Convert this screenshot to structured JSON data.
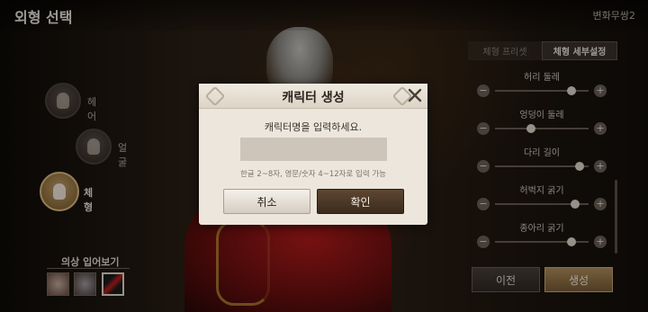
{
  "header": {
    "title": "외형 선택",
    "server": "변화무쌍2"
  },
  "categories": [
    {
      "label": "헤어",
      "icon": "hair-icon"
    },
    {
      "label": "얼굴",
      "icon": "face-icon"
    },
    {
      "label": "체형",
      "icon": "body-icon",
      "active": true
    }
  ],
  "outfit": {
    "label": "의상 입어보기"
  },
  "panel": {
    "tabs": [
      {
        "label": "체형 프리셋",
        "active": false
      },
      {
        "label": "체형 세부설정",
        "active": true
      }
    ],
    "sliders": [
      {
        "label": "허리 둘레",
        "value": 0.82
      },
      {
        "label": "엉덩이 둘레",
        "value": 0.38
      },
      {
        "label": "다리 길이",
        "value": 0.9
      },
      {
        "label": "허벅지 굵기",
        "value": 0.86
      },
      {
        "label": "종아리 굵기",
        "value": 0.82
      }
    ],
    "minus": "−",
    "plus": "+",
    "prev_label": "이전",
    "create_label": "생성"
  },
  "modal": {
    "title": "캐릭터 생성",
    "prompt": "캐릭터명을 입력하세요.",
    "input_value": "",
    "hint": "한글 2~8자, 영문/숫자 4~12자로 입력 가능",
    "cancel_label": "취소",
    "confirm_label": "확인"
  },
  "colors": {
    "accent": "#b4925f",
    "confirm": "#4a3726",
    "modal_bg": "#ece6dc"
  }
}
